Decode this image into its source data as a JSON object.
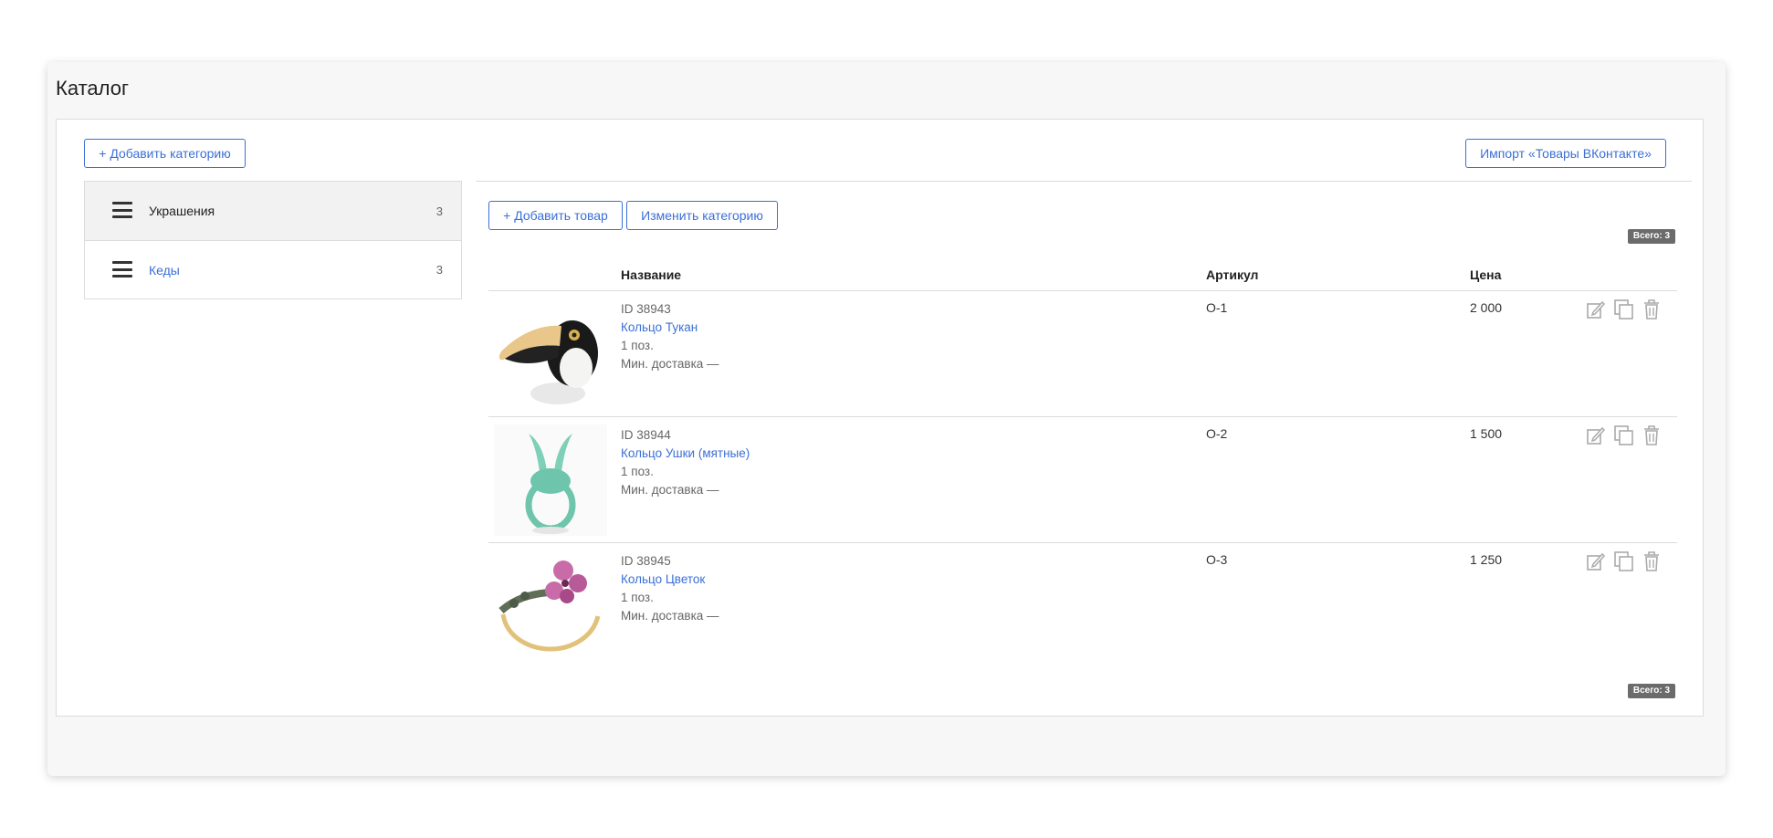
{
  "page": {
    "title": "Каталог"
  },
  "toolbar": {
    "add_category_label": "+ Добавить категорию",
    "import_label": "Импорт «Товары ВКонтакте»",
    "add_item_label": "+ Добавить товар",
    "edit_category_label": "Изменить категорию"
  },
  "categories": [
    {
      "name": "Украшения",
      "count": "3",
      "active": true
    },
    {
      "name": "Кеды",
      "count": "3",
      "active": false
    }
  ],
  "total_badge": "Всего: 3",
  "table": {
    "headers": {
      "name": "Название",
      "sku": "Артикул",
      "price": "Цена"
    },
    "rows": [
      {
        "id": "ID 38943",
        "name": "Кольцо Тукан",
        "qty": "1 поз.",
        "delivery": "Мин. доставка —",
        "sku": "О-1",
        "price": "2 000",
        "image": "toucan-ring"
      },
      {
        "id": "ID 38944",
        "name": "Кольцо Ушки (мятные)",
        "qty": "1 поз.",
        "delivery": "Мин. доставка —",
        "sku": "О-2",
        "price": "1 500",
        "image": "mint-ears-ring"
      },
      {
        "id": "ID 38945",
        "name": "Кольцо Цветок",
        "qty": "1 поз.",
        "delivery": "Мин. доставка —",
        "sku": "О-3",
        "price": "1 250",
        "image": "flower-ring"
      }
    ]
  },
  "icons": {
    "edit": "edit-icon",
    "copy": "copy-icon",
    "delete": "trash-icon",
    "drag": "menu-icon"
  },
  "colors": {
    "accent": "#3b6fd6",
    "badge": "#6b6b6b",
    "border": "#dcdcdc",
    "panel": "#f7f7f7"
  }
}
